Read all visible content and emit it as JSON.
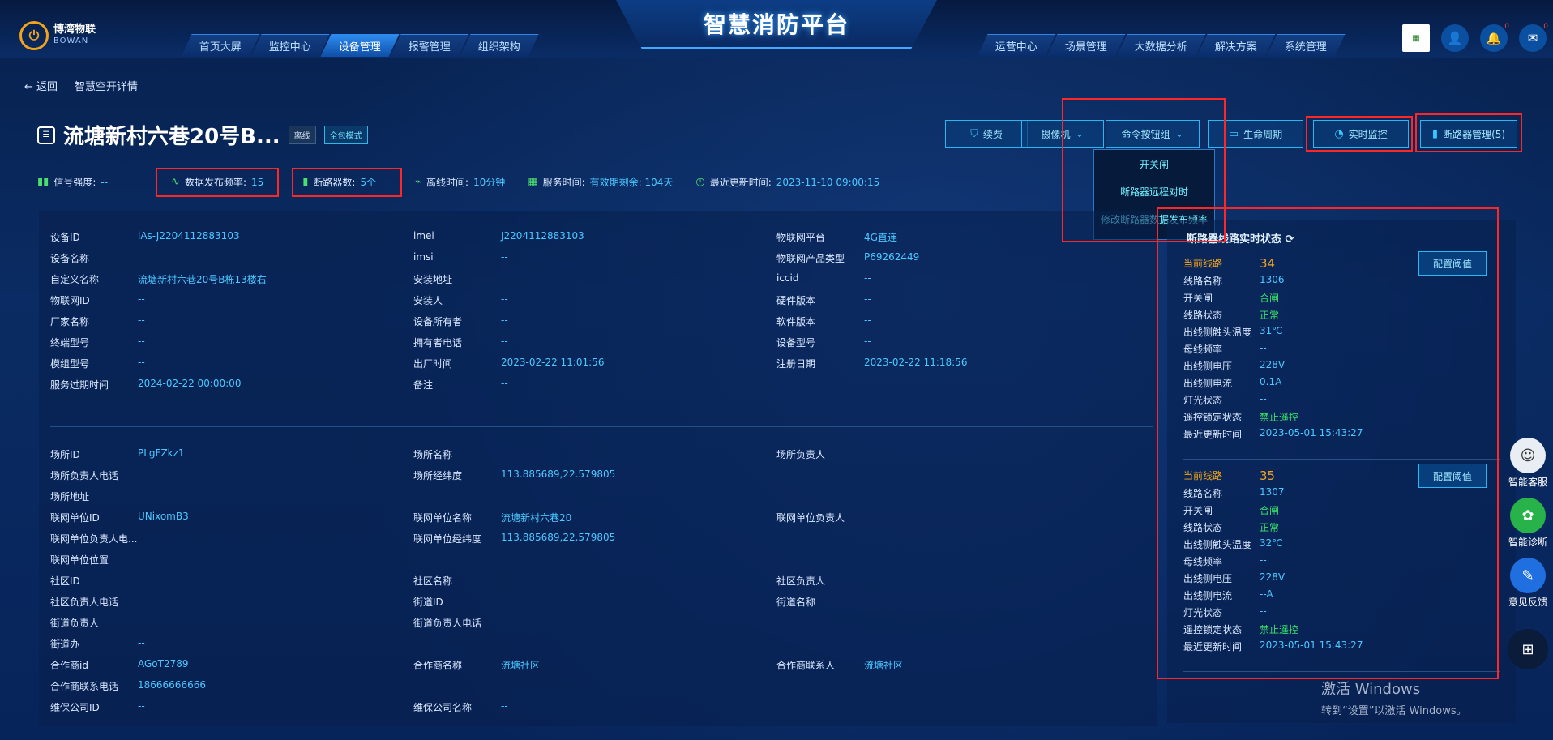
{
  "header": {
    "logo_cn": "博湾物联",
    "logo_en": "BOWAN",
    "app_title": "智慧消防平台",
    "nav_left": [
      "首页大屏",
      "监控中心",
      "设备管理",
      "报警管理",
      "组织架构"
    ],
    "nav_right": [
      "运营中心",
      "场景管理",
      "大数据分析",
      "解决方案",
      "系统管理"
    ]
  },
  "breadcrumb": {
    "back": "← 返回",
    "current": "智慧空开详情"
  },
  "device": {
    "title": "流塘新村六巷20号B...",
    "tag_offline": "离线",
    "tag_mode": "全包模式"
  },
  "actions": {
    "renew": "续费",
    "camera": "摄像机",
    "command": "命令按钮组",
    "lifecycle": "生命周期",
    "monitor": "实时监控",
    "breaker_mgmt": "断路器管理(5)"
  },
  "command_menu": [
    "开关闸",
    "断路器远程对时",
    "修改断路器数据发布频率"
  ],
  "stats": {
    "signal_label": "信号强度:",
    "signal_value": "--",
    "freq_label": "数据发布频率:",
    "freq_value": "15",
    "breakers_label": "断路器数:",
    "breakers_value": "5个",
    "offline_label": "离线时间:",
    "offline_value": "10分钟",
    "service_label": "服务时间:",
    "service_value": "有效期剩余: 104天",
    "update_label": "最近更新时间:",
    "update_value": "2023-11-10 09:00:15"
  },
  "device_info": [
    {
      "k": "设备ID",
      "v": "iAs-J2204112883103"
    },
    {
      "k": "imei",
      "v": "J2204112883103"
    },
    {
      "k": "物联网平台",
      "v": "4G直连"
    },
    {
      "k": "设备名称",
      "v": ""
    },
    {
      "k": "imsi",
      "v": "--"
    },
    {
      "k": "物联网产品类型",
      "v": "P69262449"
    },
    {
      "k": "自定义名称",
      "v": "流塘新村六巷20号B栋13楼右"
    },
    {
      "k": "安装地址",
      "v": ""
    },
    {
      "k": "iccid",
      "v": "--"
    },
    {
      "k": "物联网ID",
      "v": "--"
    },
    {
      "k": "安装人",
      "v": "--"
    },
    {
      "k": "硬件版本",
      "v": "--"
    },
    {
      "k": "厂家名称",
      "v": "--"
    },
    {
      "k": "设备所有者",
      "v": "--"
    },
    {
      "k": "软件版本",
      "v": "--"
    },
    {
      "k": "终端型号",
      "v": "--"
    },
    {
      "k": "拥有者电话",
      "v": "--"
    },
    {
      "k": "设备型号",
      "v": "--"
    },
    {
      "k": "模组型号",
      "v": "--"
    },
    {
      "k": "出厂时间",
      "v": "2023-02-22 11:01:56"
    },
    {
      "k": "注册日期",
      "v": "2023-02-22 11:18:56"
    },
    {
      "k": "服务过期时间",
      "v": "2024-02-22 00:00:00"
    },
    {
      "k": "备注",
      "v": "--"
    }
  ],
  "site_info": [
    {
      "k": "场所ID",
      "v": "PLgFZkz1"
    },
    {
      "k": "场所名称",
      "v": ""
    },
    {
      "k": "场所负责人",
      "v": ""
    },
    {
      "k": "场所负责人电话",
      "v": ""
    },
    {
      "k": "场所经纬度",
      "v": "113.885689,22.579805"
    },
    {
      "k": "场所地址",
      "v": ""
    },
    {
      "k": "联网单位ID",
      "v": "UNixomB3"
    },
    {
      "k": "联网单位名称",
      "v": "流塘新村六巷20"
    },
    {
      "k": "联网单位负责人",
      "v": ""
    },
    {
      "k": "联网单位负责人电...",
      "v": ""
    },
    {
      "k": "联网单位经纬度",
      "v": "113.885689,22.579805"
    },
    {
      "k": "联网单位位置",
      "v": ""
    },
    {
      "k": "社区ID",
      "v": "--"
    },
    {
      "k": "社区名称",
      "v": "--"
    },
    {
      "k": "社区负责人",
      "v": "--"
    },
    {
      "k": "社区负责人电话",
      "v": "--"
    },
    {
      "k": "街道ID",
      "v": "--"
    },
    {
      "k": "街道名称",
      "v": "--"
    },
    {
      "k": "街道负责人",
      "v": "--"
    },
    {
      "k": "街道负责人电话",
      "v": "--"
    },
    {
      "k": "街道办",
      "v": "--"
    },
    {
      "k": "合作商id",
      "v": "AGoT2789"
    },
    {
      "k": "合作商名称",
      "v": "流塘社区"
    },
    {
      "k": "合作商联系人",
      "v": "流塘社区"
    },
    {
      "k": "合作商联系电话",
      "v": "18666666666"
    },
    {
      "k": "维保公司ID",
      "v": "--"
    },
    {
      "k": "维保公司名称",
      "v": "--"
    }
  ],
  "status_panel": {
    "title": "断路器线路实时状态",
    "config_label": "配置阈值",
    "lines": [
      {
        "current_label": "当前线路",
        "current": "34",
        "name_label": "线路名称",
        "name": "1306",
        "switch_label": "开关闸",
        "switch": "合闸",
        "state_label": "线路状态",
        "state": "正常",
        "temp_label": "出线侧触头温度",
        "temp": "31℃",
        "bus_label": "母线频率",
        "bus": "--",
        "volt_label": "出线侧电压",
        "volt": "228V",
        "curr_label": "出线侧电流",
        "curr": "0.1A",
        "light_label": "灯光状态",
        "light": "--",
        "lock_label": "遥控锁定状态",
        "lock": "禁止遥控",
        "time_label": "最近更新时间",
        "time": "2023-05-01 15:43:27"
      },
      {
        "current_label": "当前线路",
        "current": "35",
        "name_label": "线路名称",
        "name": "1307",
        "switch_label": "开关闸",
        "switch": "合闸",
        "state_label": "线路状态",
        "state": "正常",
        "temp_label": "出线侧触头温度",
        "temp": "32℃",
        "bus_label": "母线频率",
        "bus": "--",
        "volt_label": "出线侧电压",
        "volt": "228V",
        "curr_label": "出线侧电流",
        "curr": "--A",
        "light_label": "灯光状态",
        "light": "--",
        "lock_label": "遥控锁定状态",
        "lock": "禁止遥控",
        "time_label": "最近更新时间",
        "time": "2023-05-01 15:43:27"
      }
    ]
  },
  "floating": {
    "service": "智能客服",
    "diagnose": "智能诊断",
    "feedback": "意见反馈"
  },
  "watermark": {
    "line1": "激活 Windows",
    "line2": "转到“设置”以激活 Windows。"
  },
  "icons": [
    "shield-icon",
    "camera-icon",
    "chevron-down-icon",
    "lifecycle-icon",
    "gauge-icon",
    "breaker-icon",
    "refresh-icon",
    "bell-icon",
    "mail-icon",
    "user-icon",
    "grid-icon"
  ]
}
